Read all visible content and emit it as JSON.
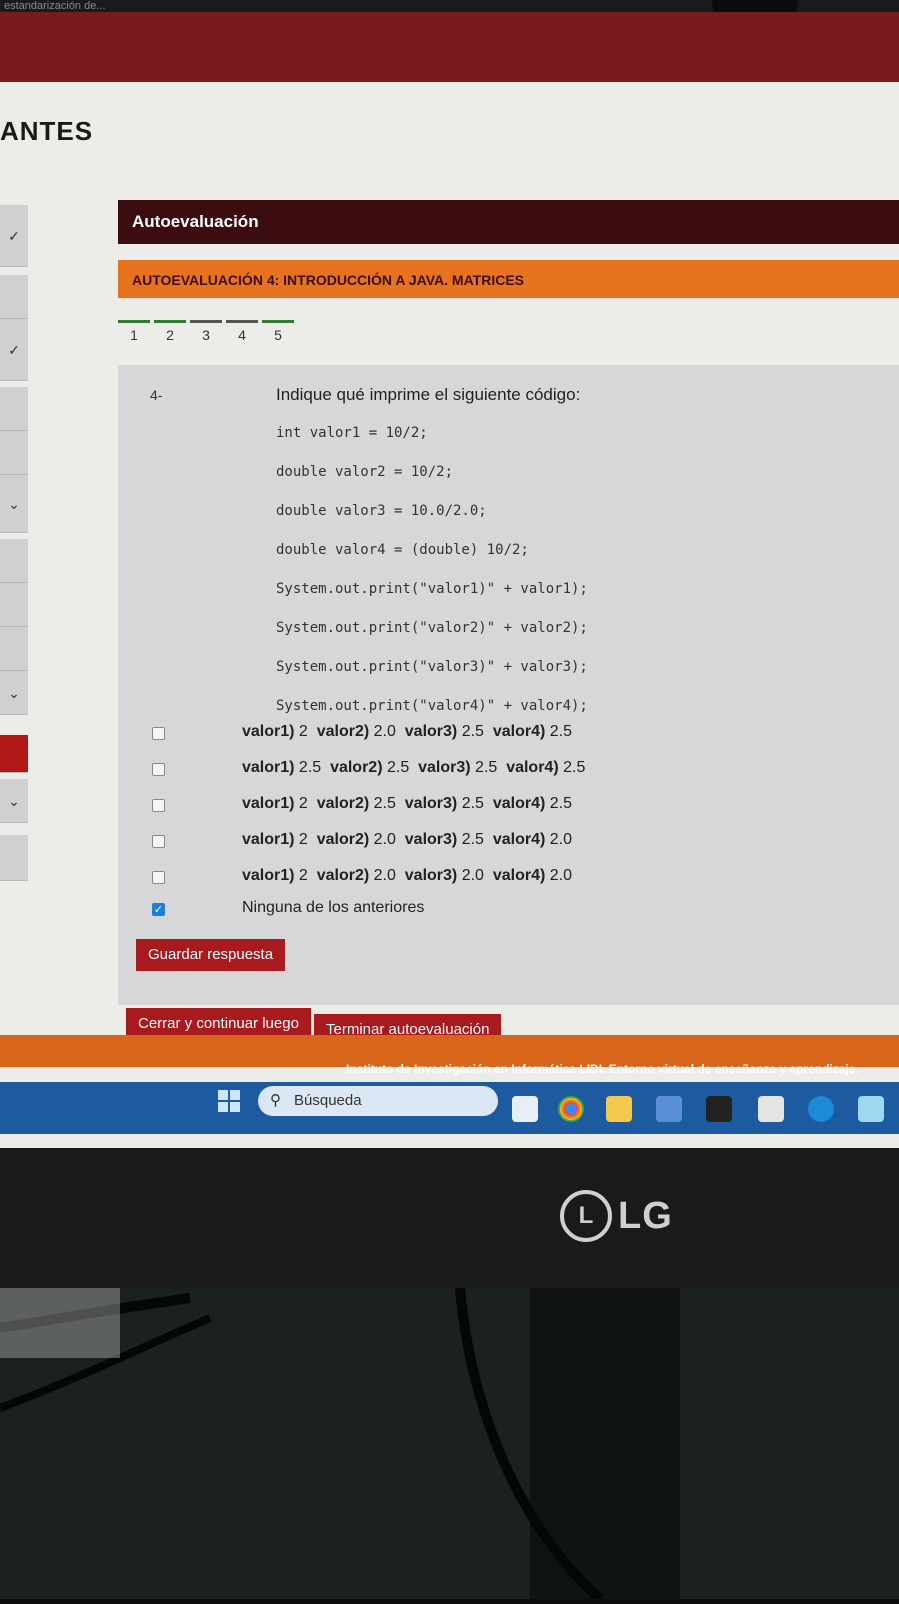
{
  "browser": {
    "tab_fragment": "estandarización de..."
  },
  "site": {
    "title_fragment": "ANTES"
  },
  "panel": {
    "header": "Autoevaluación",
    "section_title": "AUTOEVALUACIÓN 4: INTRODUCCIÓN A JAVA. MATRICES"
  },
  "pager": {
    "pages": [
      "1",
      "2",
      "3",
      "4",
      "5"
    ]
  },
  "question": {
    "number": "4-",
    "prompt": "Indique qué imprime el siguiente código:",
    "code": [
      "int valor1 = 10/2;",
      "double valor2 = 10/2;",
      "double valor3 = 10.0/2.0;",
      "double valor4 = (double) 10/2;",
      "System.out.print(\"valor1)\" + valor1);",
      "System.out.print(\"valor2)\" + valor2);",
      "System.out.print(\"valor3)\" + valor3);",
      "System.out.print(\"valor4)\" + valor4);"
    ],
    "options": [
      {
        "parts": [
          [
            "valor1)",
            "2"
          ],
          [
            "valor2)",
            "2.0"
          ],
          [
            "valor3)",
            "2.5"
          ],
          [
            "valor4)",
            "2.5"
          ]
        ],
        "checked": false
      },
      {
        "parts": [
          [
            "valor1)",
            "2.5"
          ],
          [
            "valor2)",
            "2.5"
          ],
          [
            "valor3)",
            "2.5"
          ],
          [
            "valor4)",
            "2.5"
          ]
        ],
        "checked": false
      },
      {
        "parts": [
          [
            "valor1)",
            "2"
          ],
          [
            "valor2)",
            "2.5"
          ],
          [
            "valor3)",
            "2.5"
          ],
          [
            "valor4)",
            "2.5"
          ]
        ],
        "checked": false
      },
      {
        "parts": [
          [
            "valor1)",
            "2"
          ],
          [
            "valor2)",
            "2.0"
          ],
          [
            "valor3)",
            "2.5"
          ],
          [
            "valor4)",
            "2.0"
          ]
        ],
        "checked": false
      },
      {
        "parts": [
          [
            "valor1)",
            "2"
          ],
          [
            "valor2)",
            "2.0"
          ],
          [
            "valor3)",
            "2.0"
          ],
          [
            "valor4)",
            "2.0"
          ]
        ],
        "checked": false
      },
      {
        "text": "Ninguna de los anteriores",
        "checked": true
      }
    ],
    "save_label": "Guardar respuesta"
  },
  "actions": {
    "close_label": "Cerrar y continuar luego",
    "finish_label": "Terminar autoevaluación"
  },
  "footer": {
    "text": "Instituto de Investigación en Informática LIDI. Entorno virtual de enseñanza y aprendizaje."
  },
  "taskbar": {
    "search_label": "Búsqueda"
  },
  "monitor": {
    "brand": "LG",
    "brand_mark": "L"
  },
  "colors": {
    "header_dark": "#3b0d10",
    "accent_orange": "#e8731e",
    "button_red": "#a81a1d",
    "taskbar_blue": "#1d5aa0",
    "check_blue": "#1e7fd8"
  }
}
